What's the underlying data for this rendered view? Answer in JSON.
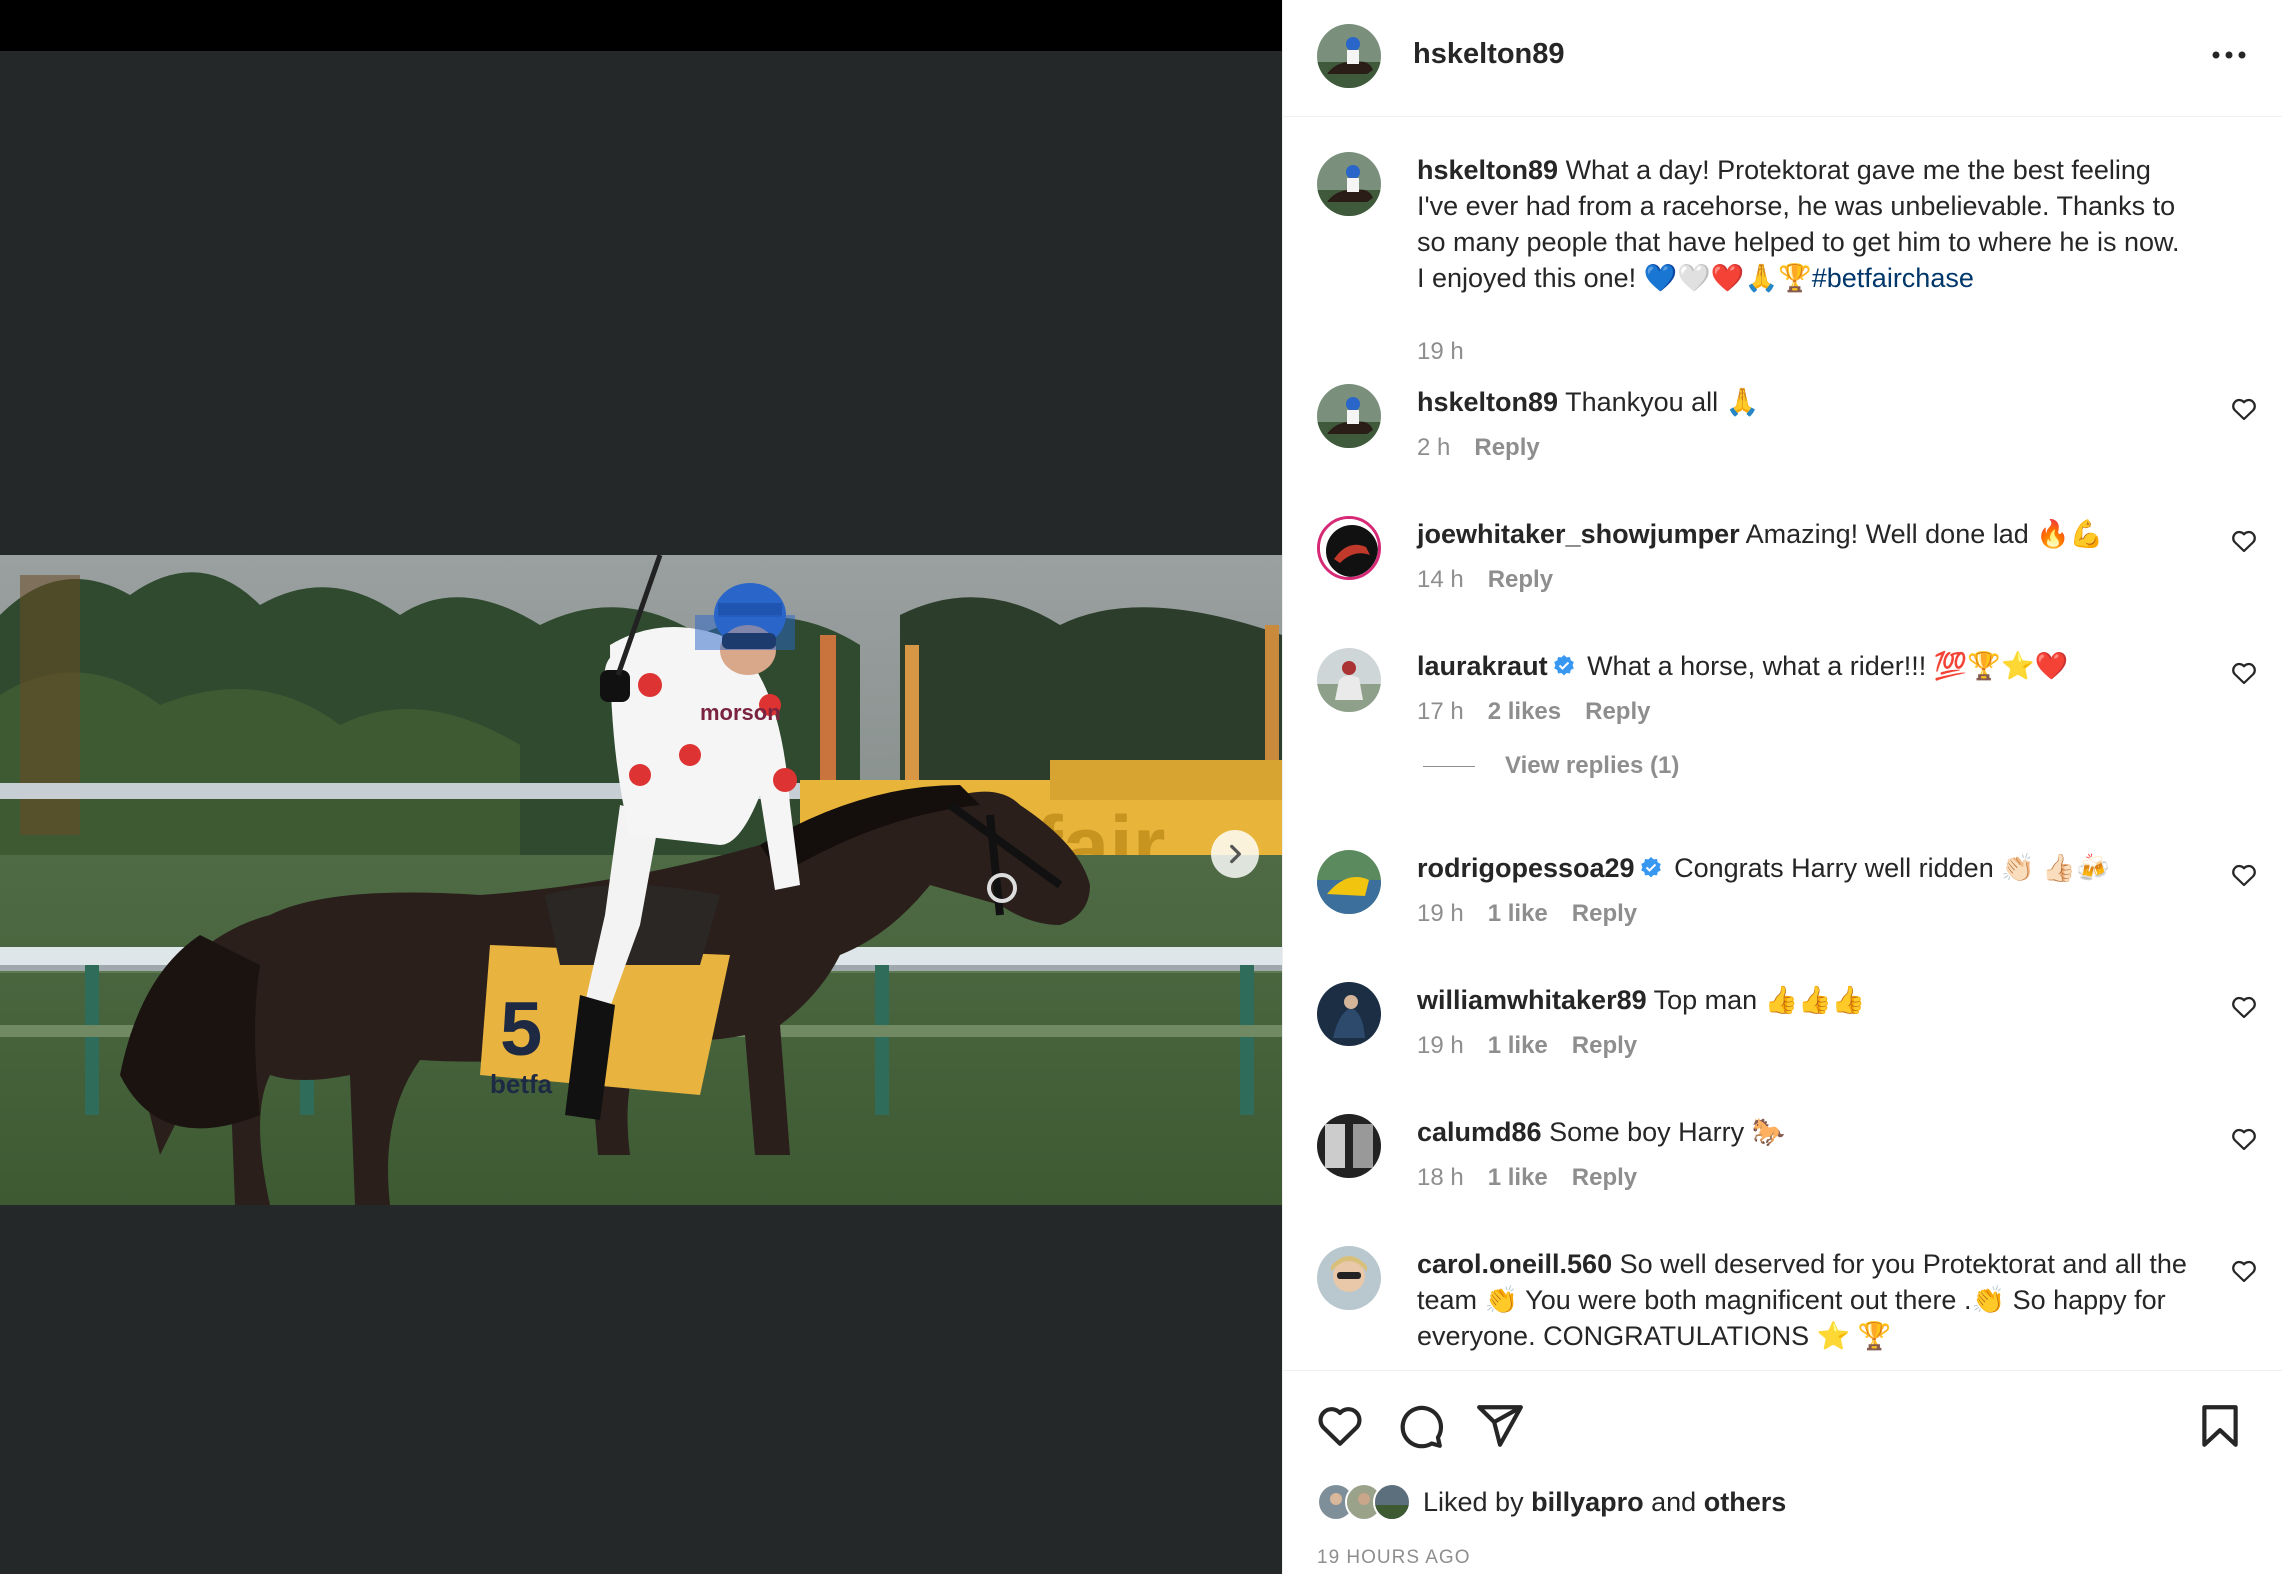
{
  "post": {
    "username": "hskelton89",
    "caption_user": "hskelton89",
    "caption_text": "What a day! Protektorat gave me the best feeling I've ever had from a racehorse, he was unbelievable. Thanks to so many people that have helped to get him to where he is now. I enjoyed this one! 💙🤍❤️🙏🏆",
    "caption_hashtag": "#betfairchase",
    "caption_time": "19 h",
    "image_alt": "Jockey celebrating on a racehorse at a Betfair race",
    "saddle_cloth_number": "5",
    "saddle_cloth_brand": "betfa",
    "board_text": "etfair",
    "silks_text": "morson"
  },
  "comments": [
    {
      "user": "hskelton89",
      "text": "Thankyou all 🙏",
      "time": "2 h",
      "likes": "",
      "reply": "Reply",
      "verified": false
    },
    {
      "user": "joewhitaker_showjumper",
      "text": "Amazing! Well done lad 🔥💪",
      "time": "14 h",
      "likes": "",
      "reply": "Reply",
      "verified": false
    },
    {
      "user": "laurakraut",
      "text": "What a horse, what a rider!!! 💯🏆⭐❤️",
      "time": "17 h",
      "likes": "2 likes",
      "reply": "Reply",
      "verified": true
    },
    {
      "user": "rodrigopessoa29",
      "text": "Congrats Harry well ridden 👏🏻 👍🏻🍻",
      "time": "19 h",
      "likes": "1 like",
      "reply": "Reply",
      "verified": true
    },
    {
      "user": "williamwhitaker89",
      "text": "Top man 👍👍👍",
      "time": "19 h",
      "likes": "1 like",
      "reply": "Reply",
      "verified": false
    },
    {
      "user": "calumd86",
      "text": "Some boy Harry 🐎",
      "time": "18 h",
      "likes": "1 like",
      "reply": "Reply",
      "verified": false
    },
    {
      "user": "carol.oneill.560",
      "text": "So well deserved for you Protektorat and all the team 👏 You were both magnificent out there .👏 So happy for everyone. CONGRATULATIONS ⭐ 🏆",
      "time": "",
      "likes": "",
      "reply": "",
      "verified": false
    }
  ],
  "view_replies": "View replies (1)",
  "liked_by": {
    "prefix": "Liked by",
    "user": "billyapro",
    "middle": "and",
    "others": "others"
  },
  "timestamp": "19 HOURS AGO",
  "icons": {
    "more": "more-options-icon",
    "like": "heart-icon",
    "comment": "comment-icon",
    "share": "share-icon",
    "save": "bookmark-icon",
    "next": "chevron-right-icon",
    "verified": "verified-badge-icon"
  },
  "colors": {
    "hashtag": "#00376b",
    "meta": "#8e8e8e",
    "verified": "#3897f0",
    "media_bg": "#242829"
  }
}
